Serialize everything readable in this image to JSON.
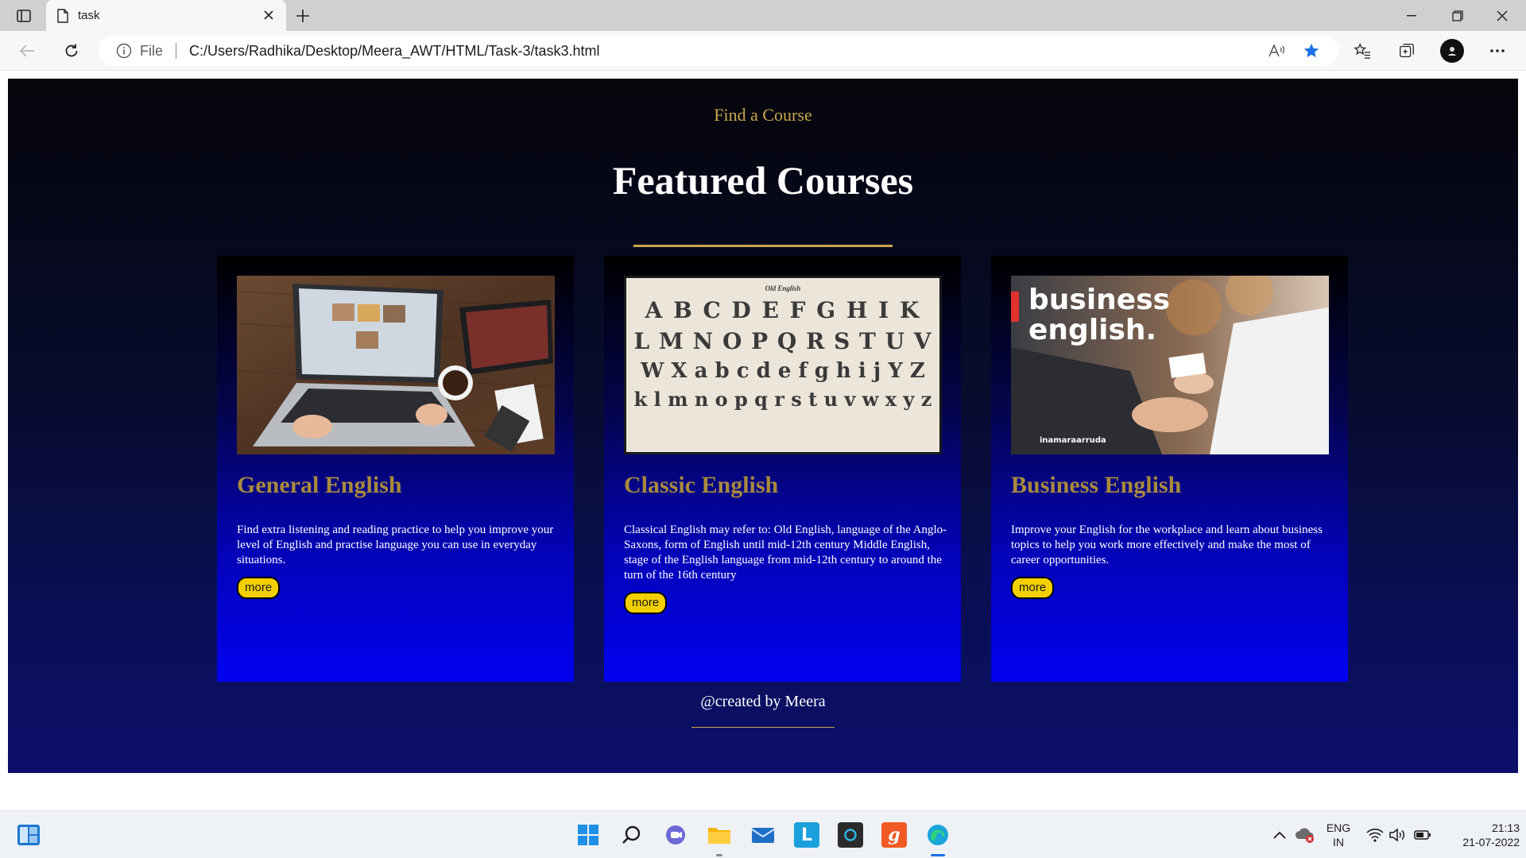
{
  "browser": {
    "tab_title": "task",
    "file_label": "File",
    "url": "C:/Users/Radhika/Desktop/Meera_AWT/HTML/Task-3/task3.html"
  },
  "page": {
    "find_course": "Find a Course",
    "heading": "Featured Courses",
    "accent_color": "#c9a64a",
    "courses": [
      {
        "title": "General English",
        "image_icon": "laptop-video-call-image",
        "description": "Find extra listening and reading practice to help you improve your level of English and practise language you can use in everyday situations.",
        "button": "more"
      },
      {
        "title": "Classic English",
        "image_icon": "gothic-alphabet-image",
        "image_text": {
          "top": "Old English",
          "line1": "A B C D E F G H I K",
          "line2": "L M N O P Q R S T U V",
          "line3": "W X a b c d e f g h i j Y Z",
          "line4": "k l m n o p q r s t u v w x y z"
        },
        "description": "Classical English may refer to: Old English, language of the Anglo-Saxons, form of English until mid-12th century Middle English, stage of the English language from mid-12th century to around the turn of the 16th century",
        "button": "more"
      },
      {
        "title": "Business English",
        "image_icon": "business-handshake-image",
        "image_text": {
          "line1": "business",
          "line2": "english.",
          "watermark": "inamaraarruda"
        },
        "description": "Improve your English for the workplace and learn about business topics to help you work more effectively and make the most of career opportunities.",
        "button": "more"
      }
    ],
    "footer": "@created by Meera"
  },
  "taskbar": {
    "lang_top": "ENG",
    "lang_bottom": "IN",
    "time": "21:13",
    "date": "21-07-2022"
  }
}
